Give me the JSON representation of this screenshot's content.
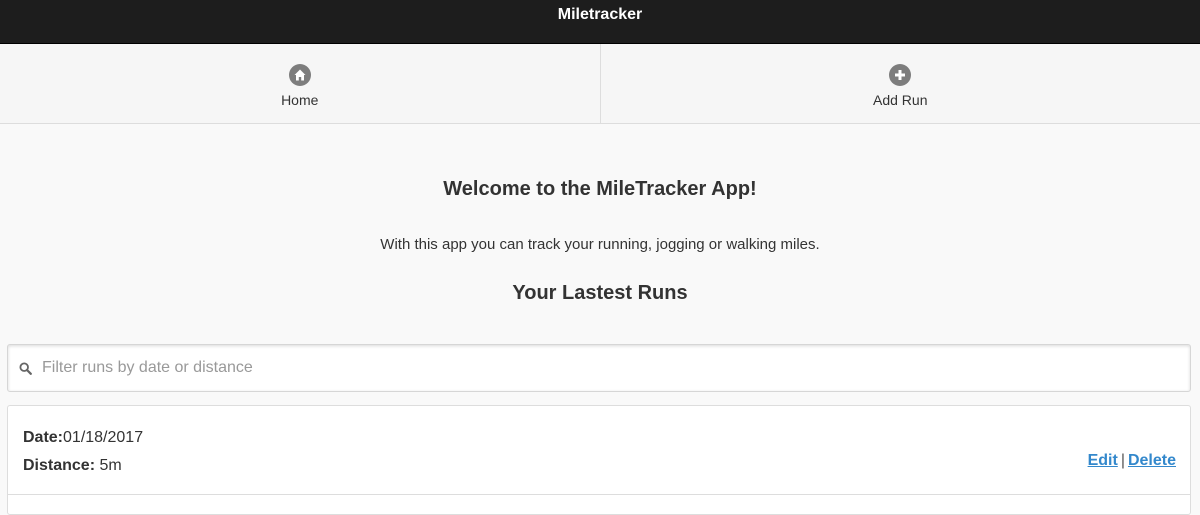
{
  "header": {
    "title": "Miletracker"
  },
  "nav": {
    "items": [
      {
        "label": "Home",
        "icon": "home-icon"
      },
      {
        "label": "Add Run",
        "icon": "plus-icon"
      }
    ]
  },
  "main": {
    "welcome": "Welcome to the MileTracker App!",
    "intro": "With this app you can track your running, jogging or walking miles.",
    "runs_title": "Your Lastest Runs"
  },
  "filter": {
    "placeholder": "Filter runs by date or distance",
    "value": ""
  },
  "runs": [
    {
      "date_label": "Date:",
      "date": "01/18/2017",
      "distance_label": "Distance:",
      "distance": "5m",
      "edit_label": "Edit",
      "separator": "|",
      "delete_label": "Delete"
    }
  ],
  "colors": {
    "header_bg": "#1d1d1d",
    "link": "#3388cc",
    "icon_bg": "#7d7d7d"
  }
}
